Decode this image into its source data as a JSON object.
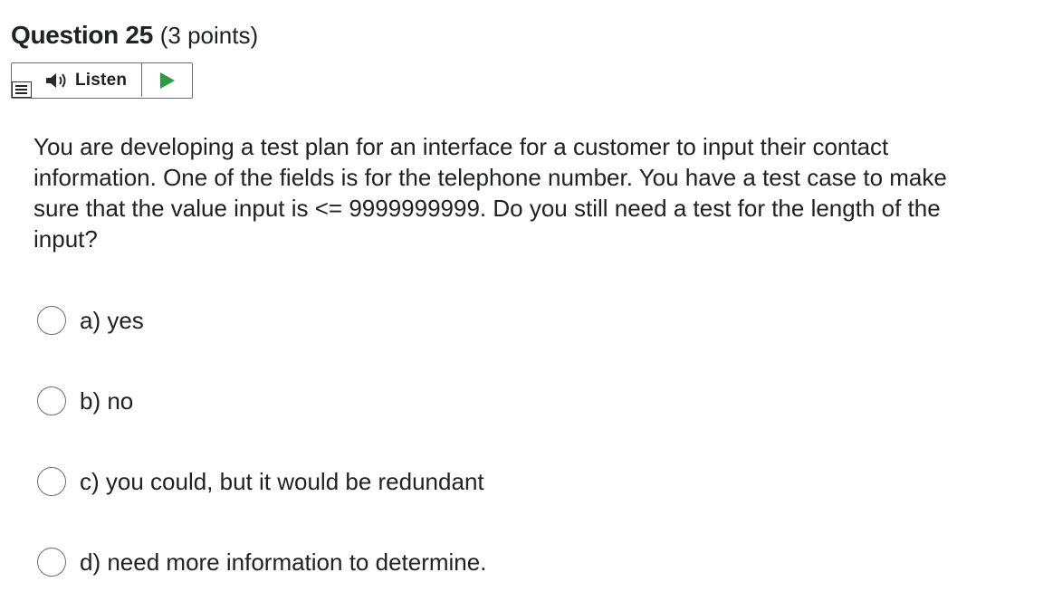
{
  "question": {
    "title": "Question 25",
    "points": "(3 points)",
    "text": "You are developing a test plan for an interface for a customer to input their contact information.  One of the fields is for the telephone number.  You have a test case to make sure that the value input is <= 9999999999.  Do you still need a test for the length of the input?"
  },
  "listen": {
    "label": "Listen",
    "play_color": "#2c9d3c"
  },
  "choices": [
    {
      "label": "a) yes",
      "selected": false
    },
    {
      "label": "b) no",
      "selected": false
    },
    {
      "label": "c) you could, but it would be redundant",
      "selected": false
    },
    {
      "label": "d) need more information to determine.",
      "selected": false
    }
  ]
}
